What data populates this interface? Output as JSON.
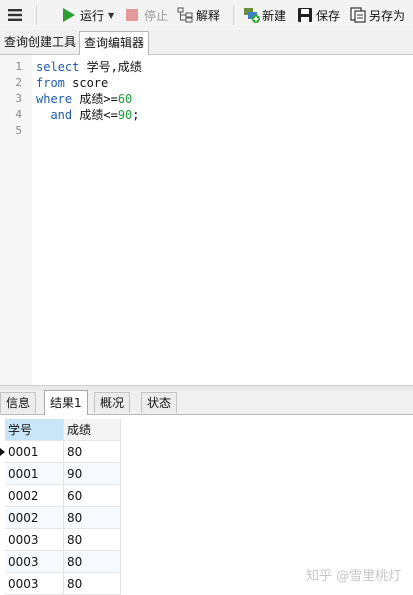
{
  "toolbar": {
    "menu_icon": "hamburger-menu-icon",
    "run_label": "运行",
    "stop_label": "停止",
    "explain_label": "解释",
    "new_label": "新建",
    "save_label": "保存",
    "save_as_label": "另存为",
    "run_color": "#2e9c2e",
    "stop_color": "#e39a9a"
  },
  "top_tabs": [
    {
      "label": "查询创建工具",
      "active": false
    },
    {
      "label": "查询编辑器",
      "active": true
    }
  ],
  "editor": {
    "line_numbers": [
      "1",
      "2",
      "3",
      "4",
      "5"
    ],
    "lines": [
      {
        "kw": "select",
        "text": " 学号,成绩",
        "num": "",
        "tail": ""
      },
      {
        "kw": "from",
        "text": " score",
        "num": "",
        "tail": ""
      },
      {
        "kw": "where",
        "text": " 成绩>=",
        "num": "60",
        "tail": ""
      },
      {
        "kw": "  and",
        "text": " 成绩<=",
        "num": "90",
        "tail": ";"
      },
      {
        "kw": "",
        "text": "",
        "num": "",
        "tail": ""
      }
    ]
  },
  "result_tabs": [
    {
      "label": "信息",
      "active": false
    },
    {
      "label": "结果1",
      "active": true
    },
    {
      "label": "概况",
      "active": false
    },
    {
      "label": "状态",
      "active": false
    }
  ],
  "grid": {
    "columns": [
      "学号",
      "成绩"
    ],
    "rows": [
      [
        "0001",
        "80"
      ],
      [
        "0001",
        "90"
      ],
      [
        "0002",
        "60"
      ],
      [
        "0002",
        "80"
      ],
      [
        "0003",
        "80"
      ],
      [
        "0003",
        "80"
      ],
      [
        "0003",
        "80"
      ]
    ]
  },
  "watermark": "知乎 @雪里桃灯"
}
